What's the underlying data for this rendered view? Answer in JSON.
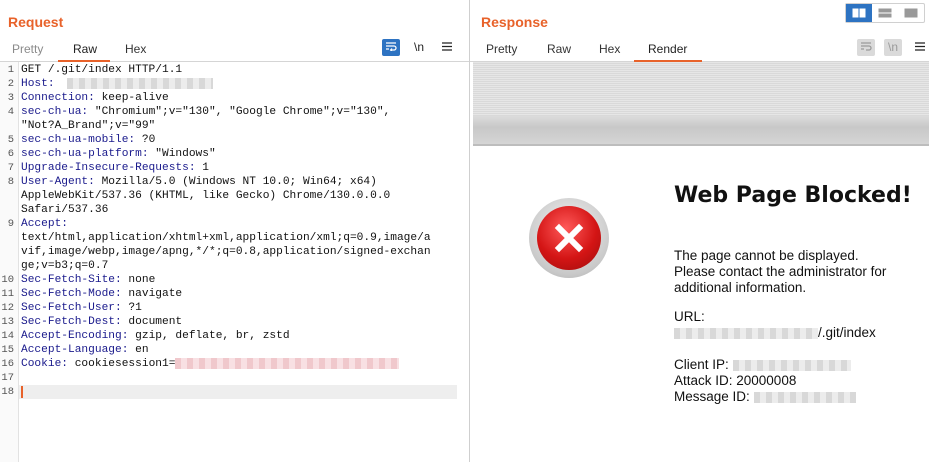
{
  "request": {
    "title": "Request",
    "tabs": [
      "Pretty",
      "Raw",
      "Hex"
    ],
    "active_tab": "Raw",
    "tools": {
      "wrap_icon": "wrap-lines-icon",
      "newline_label": "\\n",
      "menu_icon": "menu-icon"
    },
    "lines": [
      {
        "n": "1",
        "name": "",
        "value": "GET /.git/index HTTP/1.1"
      },
      {
        "n": "2",
        "name": "Host:",
        "value": " ",
        "redacted": "gray"
      },
      {
        "n": "3",
        "name": "Connection:",
        "value": " keep-alive"
      },
      {
        "n": "4",
        "name": "sec-ch-ua:",
        "value": " \"Chromium\";v=\"130\", \"Google Chrome\";v=\"130\","
      },
      {
        "n": "",
        "name": "",
        "value": "\"Not?A_Brand\";v=\"99\""
      },
      {
        "n": "5",
        "name": "sec-ch-ua-mobile:",
        "value": " ?0"
      },
      {
        "n": "6",
        "name": "sec-ch-ua-platform:",
        "value": " \"Windows\""
      },
      {
        "n": "7",
        "name": "Upgrade-Insecure-Requests:",
        "value": " 1"
      },
      {
        "n": "8",
        "name": "User-Agent:",
        "value": " Mozilla/5.0 (Windows NT 10.0; Win64; x64)"
      },
      {
        "n": "",
        "name": "",
        "value": "AppleWebKit/537.36 (KHTML, like Gecko) Chrome/130.0.0.0"
      },
      {
        "n": "",
        "name": "",
        "value": "Safari/537.36"
      },
      {
        "n": "9",
        "name": "Accept:",
        "value": ""
      },
      {
        "n": "",
        "name": "",
        "value": "text/html,application/xhtml+xml,application/xml;q=0.9,image/a"
      },
      {
        "n": "",
        "name": "",
        "value": "vif,image/webp,image/apng,*/*;q=0.8,application/signed-exchan"
      },
      {
        "n": "",
        "name": "",
        "value": "ge;v=b3;q=0.7"
      },
      {
        "n": "10",
        "name": "Sec-Fetch-Site:",
        "value": " none"
      },
      {
        "n": "11",
        "name": "Sec-Fetch-Mode:",
        "value": " navigate"
      },
      {
        "n": "12",
        "name": "Sec-Fetch-User:",
        "value": " ?1"
      },
      {
        "n": "13",
        "name": "Sec-Fetch-Dest:",
        "value": " document"
      },
      {
        "n": "14",
        "name": "Accept-Encoding:",
        "value": " gzip, deflate, br, zstd"
      },
      {
        "n": "15",
        "name": "Accept-Language:",
        "value": " en"
      },
      {
        "n": "16",
        "name": "Cookie:",
        "value": " cookiesession1=",
        "redacted": "pink"
      },
      {
        "n": "17",
        "name": "",
        "value": ""
      },
      {
        "n": "18",
        "name": "",
        "value": ""
      }
    ]
  },
  "response": {
    "title": "Response",
    "tabs": [
      "Pretty",
      "Raw",
      "Hex",
      "Render"
    ],
    "active_tab": "Render",
    "tools": {
      "wrap_icon": "wrap-lines-icon",
      "newline_label": "\\n",
      "menu_icon": "menu-icon"
    },
    "render": {
      "heading": "Web Page Blocked!",
      "msg1": "The page cannot be displayed.",
      "msg2": "Please contact the administrator for",
      "msg3": "additional information.",
      "url_label": "URL:",
      "url_suffix": "/.git/index",
      "client_ip_label": "Client IP:",
      "attack_id": "Attack ID: 20000008",
      "message_id_label": "Message ID:",
      "block_icon": "block-x-icon"
    }
  },
  "layout_buttons": [
    "split-horizontal-icon",
    "split-vertical-icon",
    "single-pane-icon"
  ],
  "colors": {
    "accent": "#e8622a",
    "selected": "#2d73c2",
    "header_name": "#1a1a8c"
  }
}
